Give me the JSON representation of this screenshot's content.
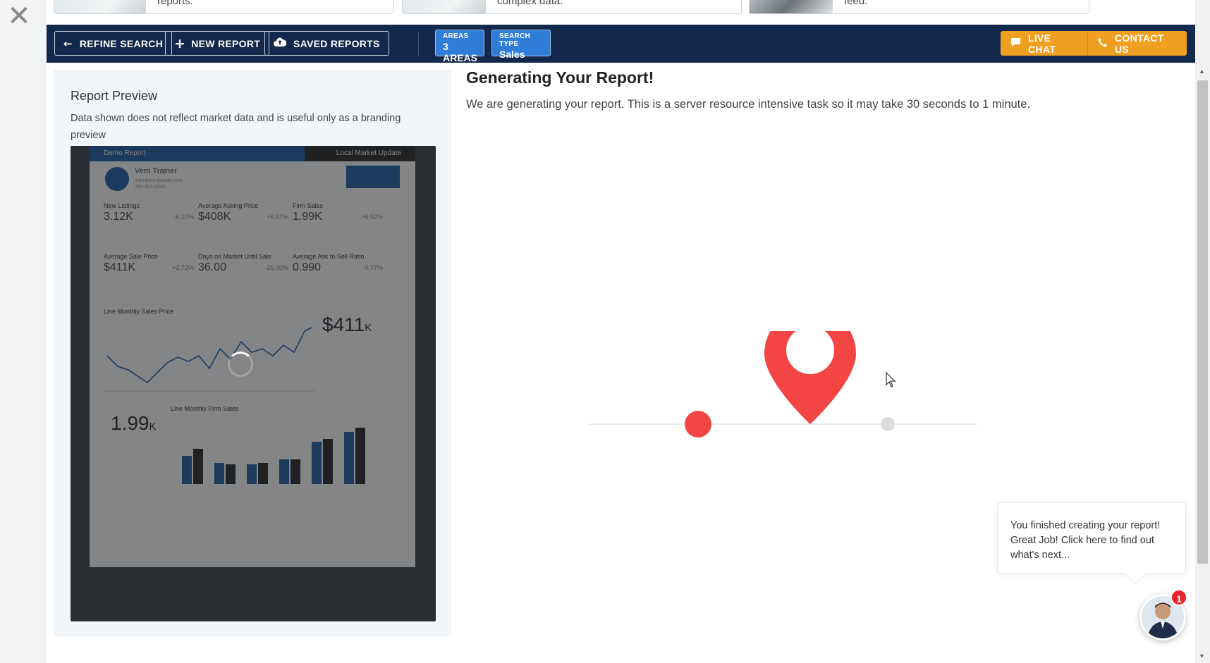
{
  "overlay": {
    "close_glyph": "✕"
  },
  "cards": [
    {
      "text": "reports."
    },
    {
      "text": "complex data."
    },
    {
      "text": "feed."
    }
  ],
  "toolbar": {
    "refine_label": "REFINE SEARCH",
    "new_report_label": "NEW REPORT",
    "saved_reports_label": "SAVED REPORTS",
    "areas_label": "AREAS",
    "areas_value": "3 AREAS",
    "search_type_label": "SEARCH TYPE",
    "search_type_value": "Sales",
    "live_chat_label": "LIVE CHAT",
    "contact_label": "CONTACT US",
    "accent": "#f0a020",
    "bar_color": "#13294b",
    "chip_color": "#2f7dd6"
  },
  "preview": {
    "title": "Report Preview",
    "description": "Data shown does not reflect market data and is useful only as a branding preview",
    "doc": {
      "left_header": "Demo Report",
      "right_header": "Local Market Update",
      "agent_name": "Vern Trainer",
      "agent_sub1": "members.thecae.com",
      "agent_sub2": "780-453-9345",
      "stats": [
        {
          "label": "New Listings",
          "value": "3.12K",
          "change": "-6.10%"
        },
        {
          "label": "Average Asking Price",
          "value": "$408K",
          "change": "+6.67%"
        },
        {
          "label": "Firm Sales",
          "value": "1.99K",
          "change": "+6.52%"
        },
        {
          "label": "Average Sale Price",
          "value": "$411K",
          "change": "+2.72%"
        },
        {
          "label": "Days on Market Until Sale",
          "value": "36.00",
          "change": "-25.00%"
        },
        {
          "label": "Average Ask to Sell Ratio",
          "value": "0.990",
          "change": "0.77%"
        }
      ],
      "line_title": "Line Monthly Sales Price",
      "line_big": "$411",
      "line_big_unit": "K",
      "bar_title": "Line Monthly Firm Sales",
      "bar_big": "1.99",
      "bar_big_unit": "K"
    }
  },
  "main": {
    "title": "Generating Your Report!",
    "description": "We are generating your report. This is a server resource intensive task so it may take 30 seconds to 1 minute.",
    "pin_color": "#f44545"
  },
  "chat": {
    "message": "You finished creating your report! Great Job! Click here to find out what's next...",
    "badge_count": "1"
  }
}
